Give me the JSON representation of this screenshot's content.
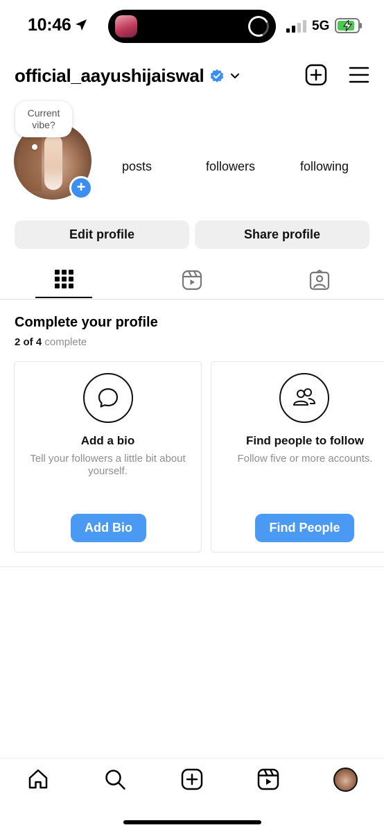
{
  "status_bar": {
    "time": "10:46",
    "network": "5G",
    "icons": [
      "location-arrow-icon",
      "signal-bars-icon",
      "battery-charging-icon"
    ]
  },
  "header": {
    "username": "official_aayushijaiswal",
    "icons": [
      "verified-badge-icon",
      "chevron-down-icon",
      "create-plus-icon",
      "menu-icon"
    ]
  },
  "profile": {
    "note_bubble": [
      "Current",
      "vibe?"
    ],
    "stats": {
      "posts_label": "posts",
      "followers_label": "followers",
      "following_label": "following"
    }
  },
  "actions": {
    "edit_profile": "Edit profile",
    "share_profile": "Share profile"
  },
  "tabs": [
    "posts-grid-icon",
    "reels-icon",
    "tagged-icon"
  ],
  "complete_profile": {
    "title": "Complete your profile",
    "progress_count": "2 of 4",
    "progress_word": "complete",
    "cards": [
      {
        "title": "Add a bio",
        "description": "Tell your followers a little bit about yourself.",
        "button": "Add Bio",
        "icon": "chat-bubble-icon"
      },
      {
        "title": "Find people to follow",
        "description": "Follow five or more accounts.",
        "button": "Find People",
        "icon": "people-icon"
      }
    ]
  },
  "bottom_nav": [
    "home-icon",
    "search-icon",
    "create-icon",
    "reels-icon",
    "profile-avatar"
  ],
  "colors": {
    "accent_blue": "#4a99f2",
    "button_gray": "#efefef",
    "muted_text": "#8e8e8e"
  }
}
